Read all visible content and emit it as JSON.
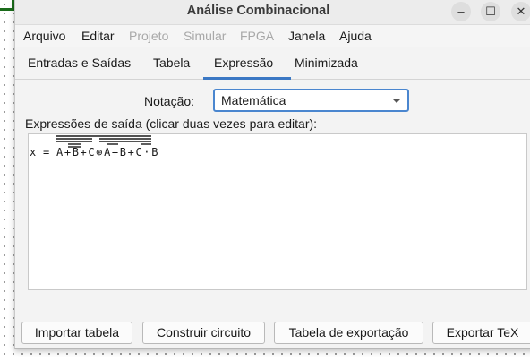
{
  "window": {
    "title": "Análise Combinacional",
    "minimize_glyph": "–",
    "maximize_glyph": "☐",
    "close_glyph": "✕"
  },
  "menubar": {
    "items": [
      {
        "label": "Arquivo",
        "enabled": true
      },
      {
        "label": "Editar",
        "enabled": true
      },
      {
        "label": "Projeto",
        "enabled": false
      },
      {
        "label": "Simular",
        "enabled": false
      },
      {
        "label": "FPGA",
        "enabled": false
      },
      {
        "label": "Janela",
        "enabled": true
      },
      {
        "label": "Ajuda",
        "enabled": true
      }
    ]
  },
  "tabs": {
    "items": [
      {
        "label": "Entradas e Saídas"
      },
      {
        "label": "Tabela"
      },
      {
        "label": "Expressão"
      },
      {
        "label": "Minimizada"
      }
    ],
    "active_index": 2
  },
  "notation": {
    "label": "Notação:",
    "value": "Matemática"
  },
  "output": {
    "label": "Expressões de saída (clicar duas vezes para editar):",
    "expression": {
      "lhs": "x",
      "equals": "=",
      "tokens": [
        "A",
        "+",
        "B",
        "+",
        "C",
        "⊕",
        "A",
        "+",
        "B",
        "+",
        "C",
        "·",
        "B"
      ]
    }
  },
  "buttons": {
    "import_table": "Importar tabela",
    "build_circuit": "Construir circuito",
    "export_table": "Tabela de exportação",
    "export_tex": "Exportar TeX"
  },
  "colors": {
    "accent": "#3b78c4",
    "disabled_text": "#a8a8a8"
  }
}
